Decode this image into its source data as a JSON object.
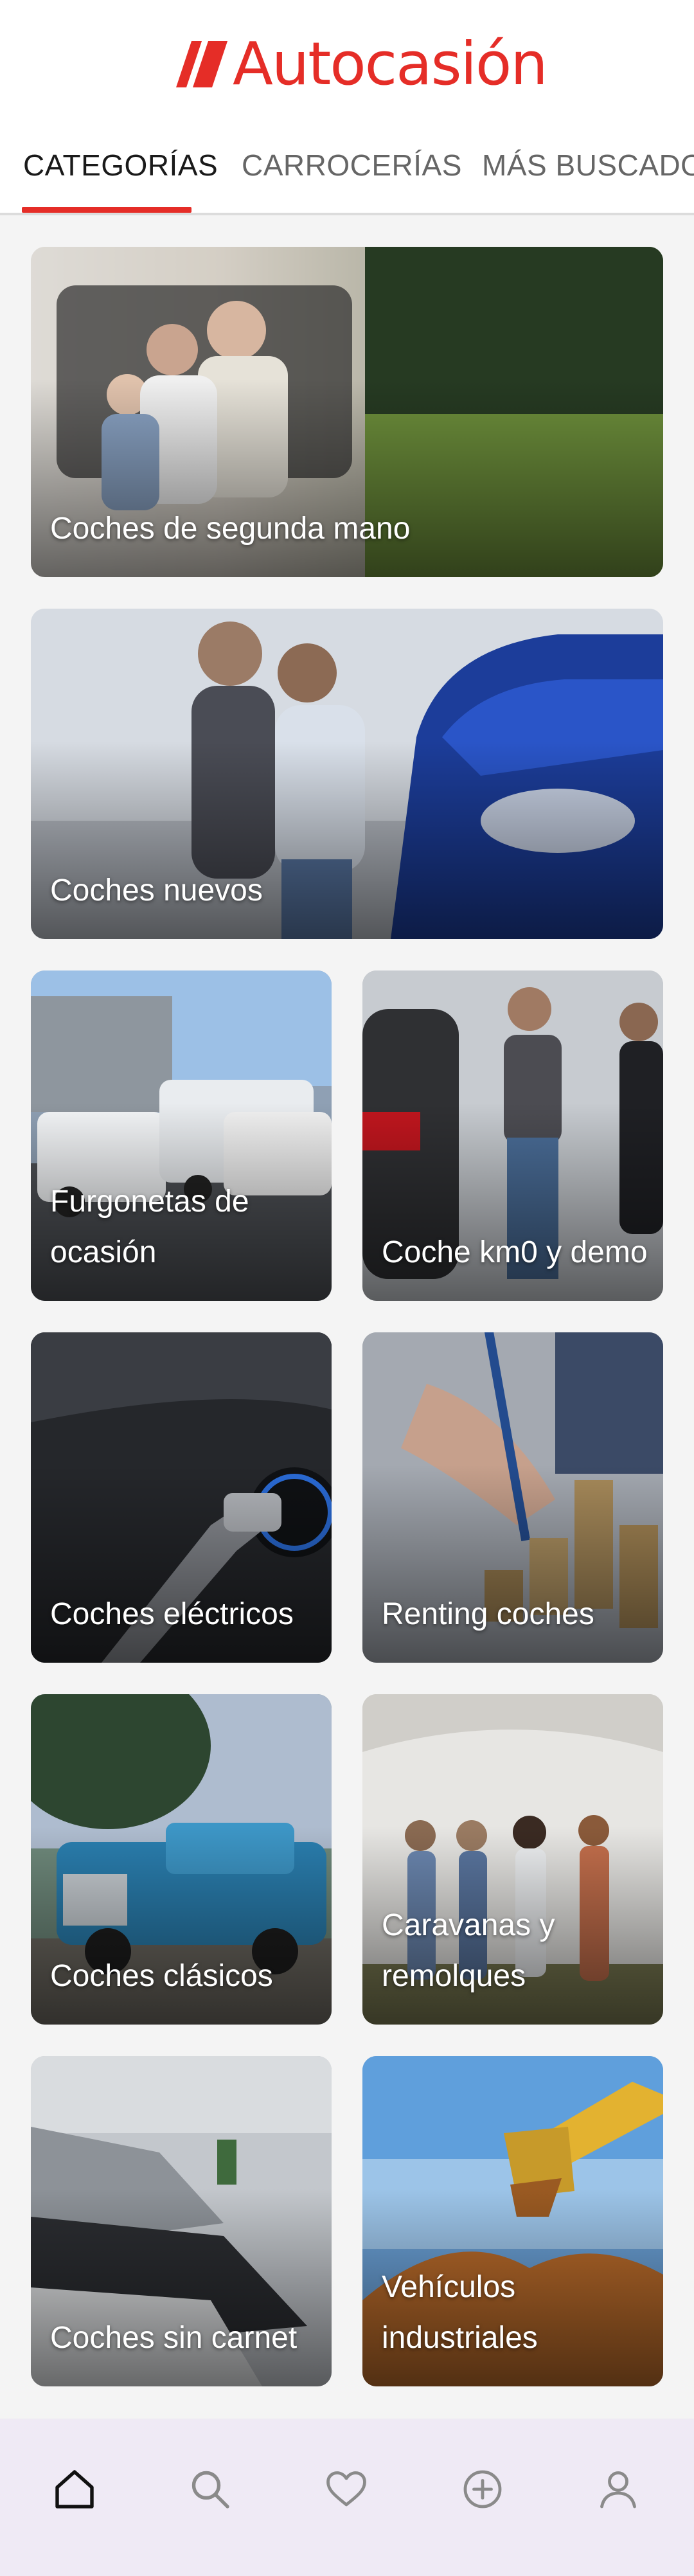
{
  "app": {
    "brand": "Autocasión",
    "brand_color": "#e52d27"
  },
  "tabs": [
    {
      "label": "CATEGORÍAS",
      "active": true
    },
    {
      "label": "CARROCERÍAS",
      "active": false
    },
    {
      "label": "MÁS BUSCADOS",
      "active": false
    }
  ],
  "categories": [
    {
      "label": "Coches de segunda mano"
    },
    {
      "label": "Coches nuevos"
    },
    {
      "label": "Furgonetas de ocasión"
    },
    {
      "label": "Coche km0 y demo"
    },
    {
      "label": "Coches eléctricos"
    },
    {
      "label": "Renting coches"
    },
    {
      "label": "Coches clásicos"
    },
    {
      "label": "Caravanas y remolques"
    },
    {
      "label": "Coches sin carnet"
    },
    {
      "label": "Vehículos industriales"
    }
  ],
  "bottom_nav": [
    {
      "icon": "home-icon",
      "active": true
    },
    {
      "icon": "search-icon",
      "active": false
    },
    {
      "icon": "heart-icon",
      "active": false
    },
    {
      "icon": "add-circle-icon",
      "active": false
    },
    {
      "icon": "profile-icon",
      "active": false
    }
  ]
}
